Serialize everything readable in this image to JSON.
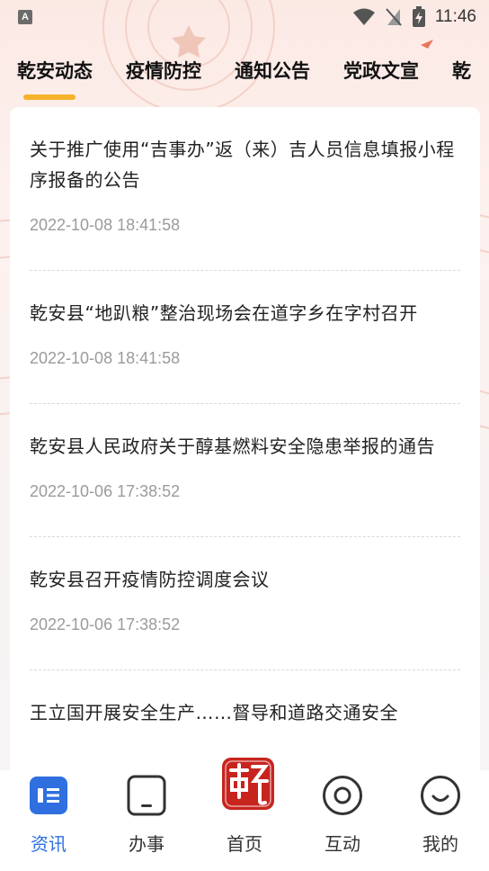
{
  "status_bar": {
    "time": "11:46",
    "left_icon": "A"
  },
  "tabs": [
    {
      "label": "乾安动态",
      "active": true
    },
    {
      "label": "疫情防控",
      "active": false
    },
    {
      "label": "通知公告",
      "active": false
    },
    {
      "label": "党政文宣",
      "active": false
    },
    {
      "label": "乾",
      "active": false
    }
  ],
  "news": [
    {
      "title": "关于推广使用“吉事办”返（来）吉人员信息填报小程序报备的公告",
      "time": "2022-10-08 18:41:58"
    },
    {
      "title": "乾安县“地趴粮”整治现场会在道字乡在字村召开",
      "time": "2022-10-08 18:41:58"
    },
    {
      "title": "乾安县人民政府关于醇基燃料安全隐患举报的通告",
      "time": "2022-10-06 17:38:52"
    },
    {
      "title": "乾安县召开疫情防控调度会议",
      "time": "2022-10-06 17:38:52"
    },
    {
      "title": "王立国开展安全生产……督导和道路交通安全",
      "time": ""
    }
  ],
  "bottom_nav": {
    "items": [
      {
        "label": "资讯",
        "icon": "news-icon",
        "active": true
      },
      {
        "label": "办事",
        "icon": "tablet-icon",
        "active": false
      },
      {
        "label": "首页",
        "icon": "seal-logo-icon",
        "active": false
      },
      {
        "label": "互动",
        "icon": "target-icon",
        "active": false
      },
      {
        "label": "我的",
        "icon": "smile-icon",
        "active": false
      }
    ]
  },
  "colors": {
    "accent_blue": "#2f6fe0",
    "tab_indicator": "#f5b22a",
    "seal_red": "#c8241e"
  }
}
